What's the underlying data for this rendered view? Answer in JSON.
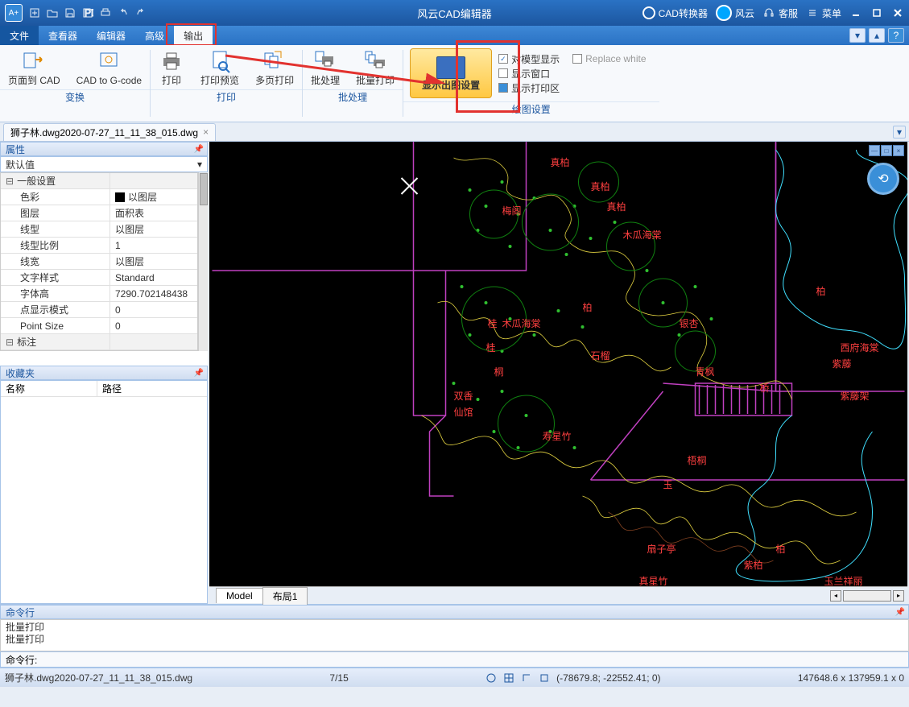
{
  "titlebar": {
    "title": "风云CAD编辑器",
    "converter": "CAD转换器",
    "brand": "风云",
    "support": "客服",
    "menu": "菜单"
  },
  "tabs": {
    "file": "文件",
    "viewer": "查看器",
    "editor": "编辑器",
    "advanced": "高级",
    "output": "输出"
  },
  "ribbon": {
    "page_to_cad": "页面到 CAD",
    "cad_to_gcode": "CAD to G-code",
    "convert": "变换",
    "print": "打印",
    "preview": "打印预览",
    "multipage": "多页打印",
    "print_group": "打印",
    "batch": "批处理",
    "batch_print": "批量打印",
    "batch_group": "批处理",
    "display_settings": "显示出图设置",
    "model_display": "对模型显示",
    "show_window": "显示窗口",
    "print_area": "显示打印区",
    "replace_white": "Replace white",
    "draw_settings": "绘图设置"
  },
  "doc": {
    "name": "狮子林.dwg2020-07-27_11_11_38_015.dwg"
  },
  "props": {
    "title": "属性",
    "default": "默认值",
    "general": "一般设置",
    "rows": [
      {
        "k": "色彩",
        "v": "以图层",
        "swatch": true
      },
      {
        "k": "图层",
        "v": "面积表"
      },
      {
        "k": "线型",
        "v": "以图层"
      },
      {
        "k": "线型比例",
        "v": "1"
      },
      {
        "k": "线宽",
        "v": "以图层"
      },
      {
        "k": "文字样式",
        "v": "Standard"
      },
      {
        "k": "字体高",
        "v": "7290.702148438"
      },
      {
        "k": "点显示模式",
        "v": "0"
      },
      {
        "k": "Point Size",
        "v": "0"
      }
    ],
    "annotation": "标注"
  },
  "fav": {
    "title": "收藏夹",
    "name": "名称",
    "path": "路径"
  },
  "canvas": {
    "labels": [
      "真柏",
      "梅阁",
      "真柏",
      "真柏",
      "木瓜海棠",
      "柏",
      "柏",
      "桂",
      "桂",
      "桐",
      "木瓜海棠",
      "银杏",
      "石榴",
      "西府海棠",
      "紫藤",
      "青枫",
      "桥",
      "紫藤架",
      "双香",
      "仙馆",
      "寿星竹",
      "梧桐",
      "玉",
      "扇子亭",
      "柏",
      "紫柏",
      "真星竹",
      "玉兰祥丽"
    ],
    "x_mark": "×"
  },
  "layout": {
    "model": "Model",
    "layout1": "布局1"
  },
  "cmd": {
    "title": "命令行",
    "line1": "批量打印",
    "line2": "批量打印",
    "prompt": "命令行:"
  },
  "status": {
    "file": "狮子林.dwg2020-07-27_11_11_38_015.dwg",
    "page": "7/15",
    "coords": "(-78679.8; -22552.41; 0)",
    "dims": "147648.6 x 137959.1 x 0"
  }
}
